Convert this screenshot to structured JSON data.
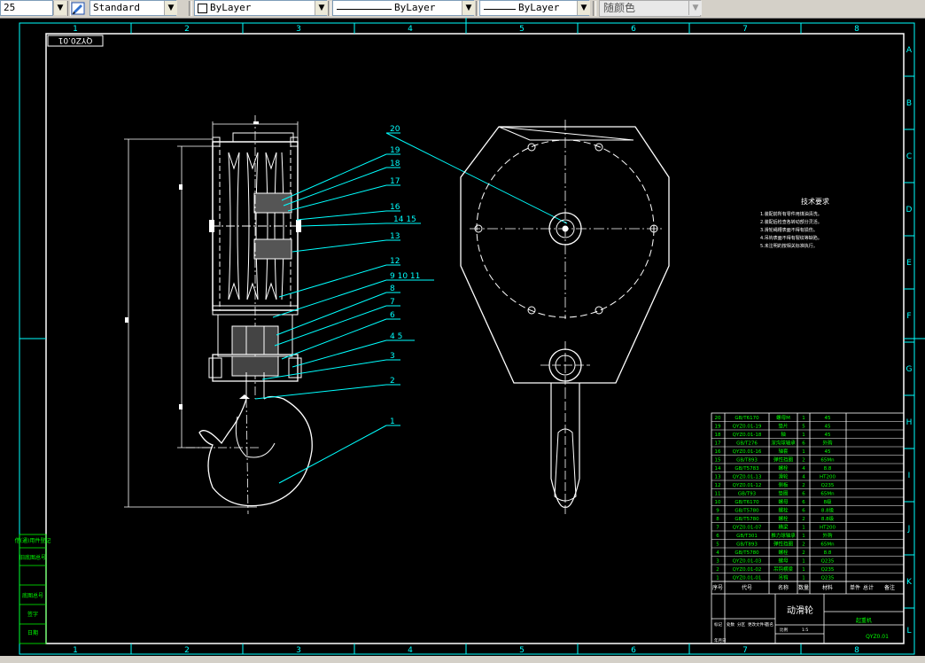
{
  "toolbar": {
    "scale_value": "25",
    "text_style": "Standard",
    "layer_value": "ByLayer",
    "linetype_value": "ByLayer",
    "lineweight_value": "ByLayer",
    "color_value": "随颜色"
  },
  "frame": {
    "column_labels": [
      "1",
      "2",
      "3",
      "4",
      "5",
      "6",
      "7",
      "8"
    ],
    "row_labels": [
      "A",
      "B",
      "C",
      "D",
      "E",
      "F",
      "G",
      "H",
      "I",
      "J",
      "K",
      "L"
    ],
    "drawing_number_rotated": "QYZ0.01"
  },
  "callouts": [
    "20",
    "19",
    "18",
    "17",
    "16",
    "14 15",
    "13",
    "12",
    "9 10 11",
    "8",
    "7",
    "6",
    "4 5",
    "3",
    "2",
    "1"
  ],
  "tech_requirements": {
    "title": "技术要求",
    "lines": [
      "1.装配前所有零件用煤油清洗。",
      "2.装配后检查各转动部分灵活。",
      "3.滑轮绳槽表面不得有损伤。",
      "4.吊钩表面不得有裂纹等缺陷。",
      "5.未注明的按相关标准执行。"
    ]
  },
  "parts_list": {
    "rows": [
      [
        "20",
        "GB/T6170",
        "螺母M",
        "1",
        "45"
      ],
      [
        "19",
        "QYZ0.01-19",
        "垫片",
        "5",
        "45"
      ],
      [
        "18",
        "QYZ0.01-18",
        "轴",
        "1",
        "45"
      ],
      [
        "17",
        "GB/T276",
        "深沟球轴承",
        "6",
        "外购"
      ],
      [
        "16",
        "QYZ0.01-16",
        "轴套",
        "1",
        "45"
      ],
      [
        "15",
        "GB/T893",
        "弹性挡圈",
        "2",
        "65Mn"
      ],
      [
        "14",
        "GB/T5783",
        "螺栓",
        "4",
        "8.8"
      ],
      [
        "13",
        "QYZ0.01-13",
        "滑轮",
        "4",
        "HT200"
      ],
      [
        "12",
        "QYZ0.01-12",
        "侧板",
        "2",
        "Q235"
      ],
      [
        "11",
        "GB/T93",
        "垫圈",
        "6",
        "65Mn"
      ],
      [
        "10",
        "GB/T6170",
        "螺母",
        "6",
        "8级"
      ],
      [
        "9",
        "GB/T5780",
        "螺栓",
        "6",
        "8.8级"
      ],
      [
        "8",
        "GB/T5780",
        "螺栓",
        "2",
        "8.8级"
      ],
      [
        "7",
        "QYZ0.01-07",
        "横梁",
        "1",
        "HT200"
      ],
      [
        "6",
        "GB/T301",
        "推力球轴承",
        "1",
        "外购"
      ],
      [
        "5",
        "GB/T893",
        "弹性挡圈",
        "2",
        "65Mn"
      ],
      [
        "4",
        "GB/T5780",
        "螺栓",
        "2",
        "8.8"
      ],
      [
        "3",
        "QYZ0.01-03",
        "螺母",
        "1",
        "Q235"
      ],
      [
        "2",
        "QYZ0.01-02",
        "吊钩横梁",
        "1",
        "Q235"
      ],
      [
        "1",
        "QYZ0.01-01",
        "吊钩",
        "1",
        "Q235"
      ]
    ],
    "header": [
      "序号",
      "代号",
      "名称",
      "数量",
      "材料"
    ],
    "extra_header": [
      "单件",
      "总计",
      "备注"
    ]
  },
  "title_block": {
    "title": "动滑轮",
    "drawing_no": "QYZ0.01",
    "company": "起重机",
    "labels": [
      "标记",
      "处数",
      "分区",
      "更改文件号",
      "签名",
      "年月日"
    ],
    "scale_label": "比例",
    "scale": "1:5"
  },
  "left_stamps": [
    "借(通)用件登记",
    "旧底图总号",
    "底图总号",
    "签字",
    "日期"
  ],
  "colors": {
    "frame": "#ffffff",
    "grid_labels": "#00ffff",
    "table": "#ffffff",
    "text_green": "#00ff00",
    "leader": "#00ffff",
    "background": "#000000"
  }
}
